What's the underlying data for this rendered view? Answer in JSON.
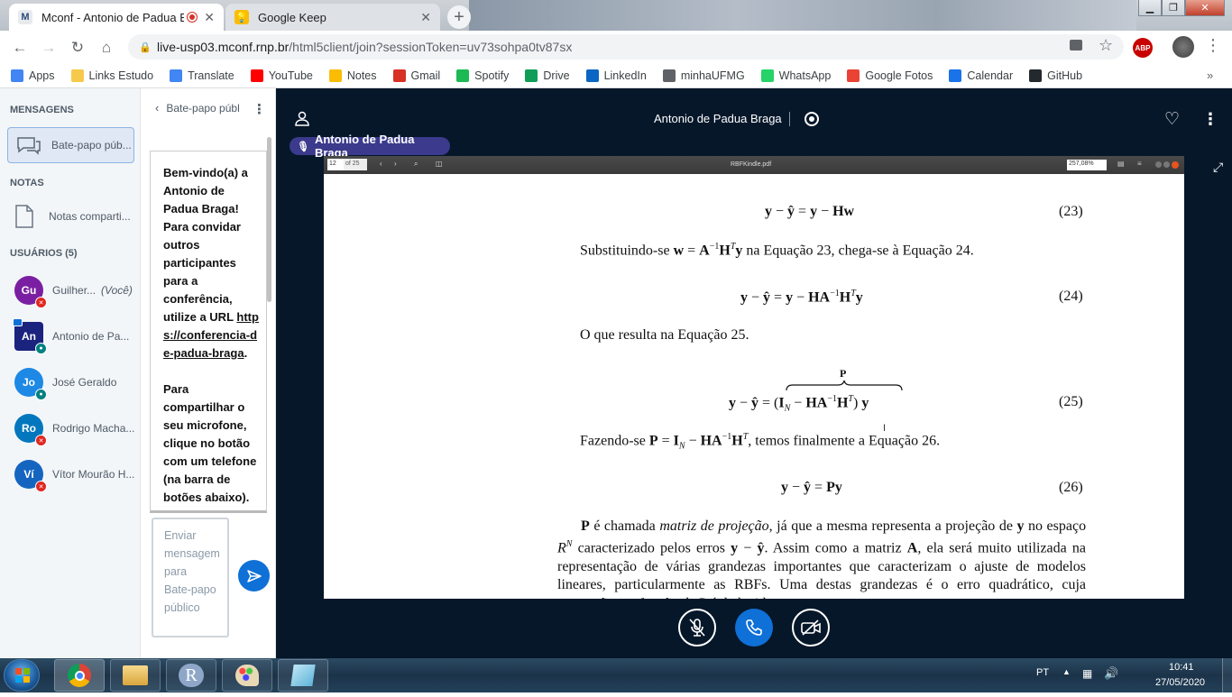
{
  "browser": {
    "tabs": [
      {
        "title": "Mconf - Antonio de Padua B",
        "favicon": "M"
      },
      {
        "title": "Google Keep",
        "favicon": ""
      }
    ],
    "url_host": "live-usp03.mconf.rnp.br",
    "url_path": "/html5client/join?sessionToken=uv73sohpa0tv87sx",
    "bookmarks": [
      {
        "label": "Apps",
        "color": "#4285f4",
        "icon": "apps-icon"
      },
      {
        "label": "Links Estudo",
        "color": "#f7c94b",
        "icon": "folder-icon"
      },
      {
        "label": "Translate",
        "color": "#4285f4",
        "icon": "translate-icon"
      },
      {
        "label": "YouTube",
        "color": "#ff0000",
        "icon": "youtube-icon"
      },
      {
        "label": "Notes",
        "color": "#fbbc04",
        "icon": "keep-icon"
      },
      {
        "label": "Gmail",
        "color": "#d93025",
        "icon": "gmail-icon"
      },
      {
        "label": "Spotify",
        "color": "#1db954",
        "icon": "spotify-icon"
      },
      {
        "label": "Drive",
        "color": "#0f9d58",
        "icon": "drive-icon"
      },
      {
        "label": "LinkedIn",
        "color": "#0a66c2",
        "icon": "linkedin-icon"
      },
      {
        "label": "minhaUFMG",
        "color": "#5f6368",
        "icon": "globe-icon"
      },
      {
        "label": "WhatsApp",
        "color": "#25d366",
        "icon": "whatsapp-icon"
      },
      {
        "label": "Google Fotos",
        "color": "#ea4335",
        "icon": "photos-icon"
      },
      {
        "label": "Calendar",
        "color": "#1a73e8",
        "icon": "calendar-icon"
      },
      {
        "label": "GitHub",
        "color": "#24292e",
        "icon": "github-icon"
      }
    ],
    "extension_badge": "ABP"
  },
  "sidebar": {
    "messages_title": "MENSAGENS",
    "public_chat": "Bate-papo púb...",
    "notes_title": "NOTAS",
    "shared_notes": "Notas comparti...",
    "users_title": "USUÁRIOS (5)",
    "users": [
      {
        "initials": "Gu",
        "name": "Guilher...",
        "you": "(Você)",
        "color": "#7b1fa2",
        "mic": "muted"
      },
      {
        "initials": "An",
        "name": "Antonio de Pa...",
        "you": "",
        "color": "#1a237e",
        "mic": "on"
      },
      {
        "initials": "Jo",
        "name": "José Geraldo",
        "you": "",
        "color": "#1e88e5",
        "mic": "on"
      },
      {
        "initials": "Ro",
        "name": "Rodrigo Macha...",
        "you": "",
        "color": "#0277bd",
        "mic": "muted"
      },
      {
        "initials": "Ví",
        "name": "Vítor Mourão H...",
        "you": "",
        "color": "#1565c0",
        "mic": "muted"
      }
    ]
  },
  "chat": {
    "header": "Bate-papo públ",
    "welcome_text": "Bem-vindo(a) a Antonio de Padua Braga! Para convidar outros participantes para a conferência, utilize a URL",
    "url": "https://conferencia-de-padua-braga",
    "welcome_end": ".",
    "mic_text": "Para compartilhar o seu microfone, clique no botão com um telefone (na barra de botões abaixo).",
    "input_placeholder": "Enviar mensagem para Bate-papo público"
  },
  "meeting": {
    "title": "Antonio de Padua Braga",
    "presenter": "Antonio de Padua Braga"
  },
  "document": {
    "page_field": "12",
    "page_total": "of 25",
    "filename": "RBFKindle.pdf",
    "zoom": "257,08%",
    "eq23_num": "(23)",
    "para1": "Substituindo-se",
    "para1b": "na Equação 23, chega-se à Equação 24.",
    "eq24_num": "(24)",
    "para2": "O que resulta na Equação 25.",
    "eq25_num": "(25)",
    "para3": "Fazendo-se",
    "para3b": ", temos finalmente a Equação 26.",
    "eq26_num": "(26)",
    "para4_l1a": "é chamada",
    "para4_l1b": "matriz de projeção",
    "para4_l1c": ", já que a mesma representa a projeção",
    "para4_l2": "de",
    "para4_l2b": "no espaço",
    "para4_l2c": "caracterizado pelos erros",
    "para4_l2d": ". Assim como a matriz",
    "para4_l3": ", ela será muito utilizada na representação de várias grandezas importantes",
    "para4_l4": "que caracterizam o ajuste de modelos lineares, particularmente as RBFs. Uma",
    "para4_l5": "destas grandezas é o erro quadrático, cuja expressão em função de P é deduzida"
  },
  "taskbar": {
    "lang": "PT",
    "time": "10:41",
    "date": "27/05/2020"
  }
}
